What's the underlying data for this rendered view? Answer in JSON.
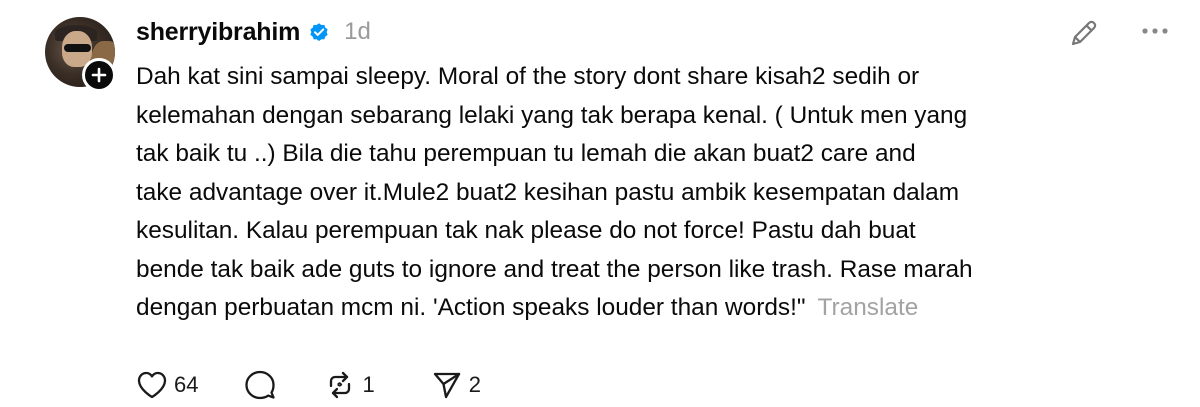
{
  "post": {
    "username": "sherryibrahim",
    "timestamp": "1d",
    "body_lines": [
      "Dah kat sini sampai sleepy. Moral of the story dont share kisah2 sedih or",
      "kelemahan dengan sebarang lelaki yang tak berapa kenal. ( Untuk men yang",
      "tak baik tu ..) Bila die tahu perempuan tu lemah die akan buat2 care and",
      "take advantage over it.Mule2 buat2 kesihan pastu ambik kesempatan dalam",
      "kesulitan. Kalau perempuan tak nak please do not force! Pastu dah buat",
      "bende tak baik ade guts to ignore and treat the person like trash. Rase marah",
      "dengan perbuatan mcm ni. 'Action speaks louder than words!\""
    ],
    "translate_label": "Translate",
    "actions": {
      "like_count": "64",
      "repost_count": "1",
      "share_count": "2"
    }
  },
  "icons": {
    "verified": "verified-badge-icon",
    "follow": "plus-icon",
    "edit": "pencil-icon",
    "more": "more-horizontal-icon",
    "like": "heart-icon",
    "reply": "comment-icon",
    "repost": "repost-icon",
    "share": "send-icon"
  },
  "colors": {
    "verified": "#0095f6",
    "muted": "#9a9a9a"
  }
}
